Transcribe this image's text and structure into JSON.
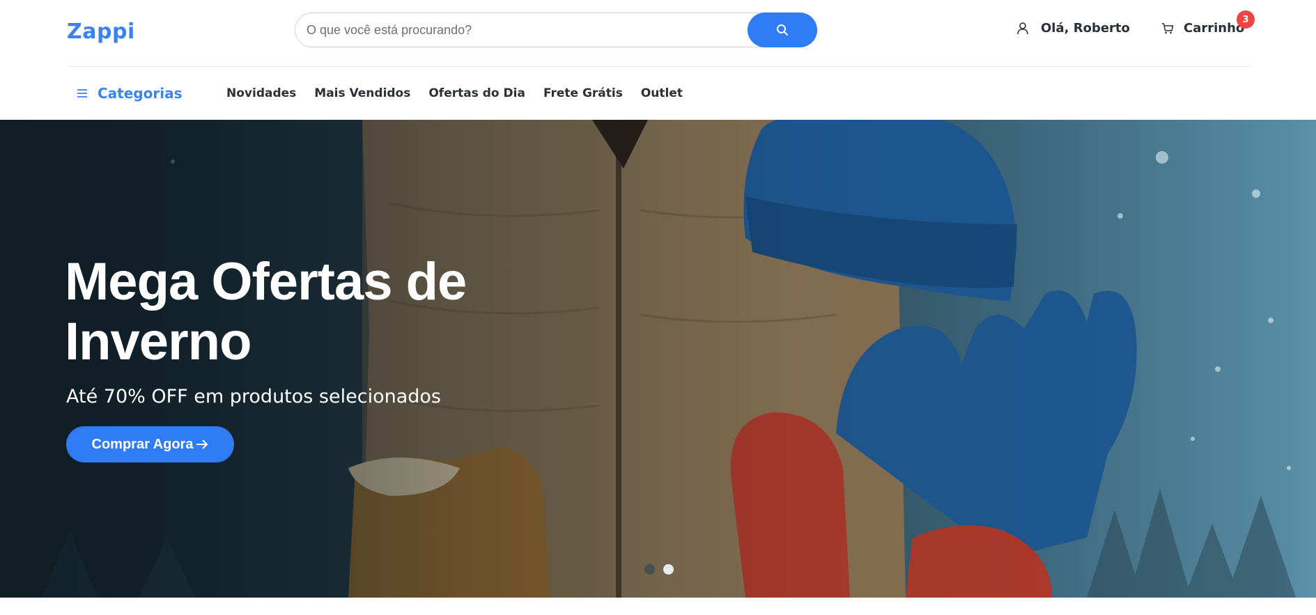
{
  "header": {
    "logo": "Zappi",
    "search_placeholder": "O que você está procurando?",
    "search_icon": "search-icon",
    "user_greeting": "Olá, Roberto",
    "user_icon": "user-icon",
    "cart_label": "Carrinho",
    "cart_icon": "cart-icon",
    "cart_count": "3"
  },
  "nav": {
    "categories_label": "Categorias",
    "menu_icon": "menu-icon",
    "items": [
      {
        "label": "Novidades"
      },
      {
        "label": "Mais Vendidos"
      },
      {
        "label": "Ofertas do Dia"
      },
      {
        "label": "Frete Grátis"
      },
      {
        "label": "Outlet"
      }
    ]
  },
  "hero": {
    "title": "Mega Ofertas de Inverno",
    "subtitle": "Até 70% OFF em produtos selecionados",
    "cta_label": "Comprar Agora",
    "cta_icon": "arrow-right-icon",
    "slides_total": 2,
    "active_slide": 2
  },
  "colors": {
    "brand": "#3b82f6",
    "button": "#2f7cf6",
    "badge": "#ef4444"
  }
}
